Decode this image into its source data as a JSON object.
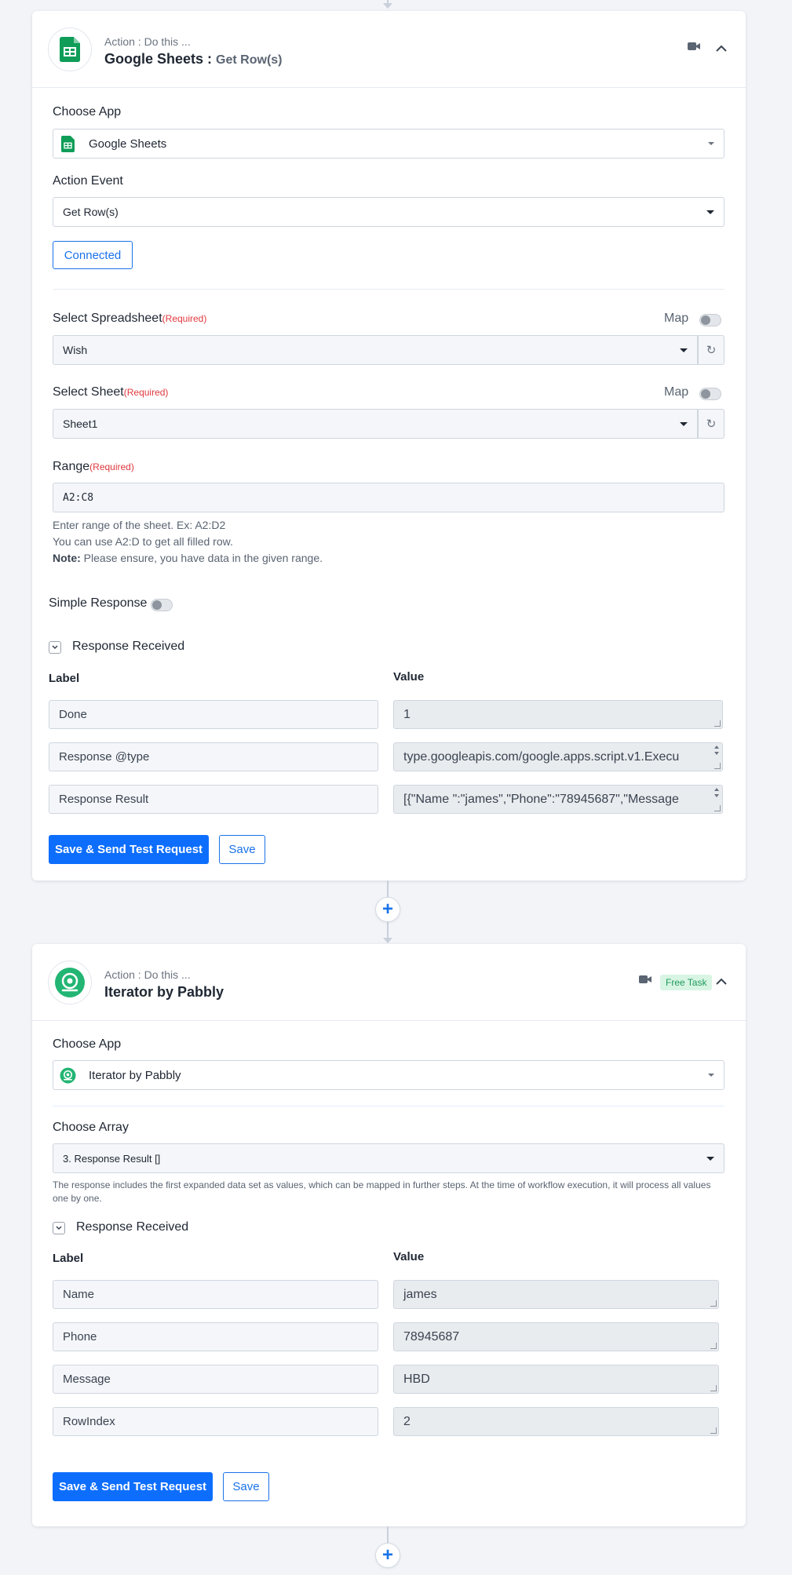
{
  "step1": {
    "header_sub": "Action : Do this ...",
    "app_name": "Google Sheets :",
    "action_name": "Get Row(s)",
    "choose_app_label": "Choose App",
    "choose_app_value": "Google Sheets",
    "action_event_label": "Action Event",
    "action_event_value": "Get Row(s)",
    "connected_label": "Connected",
    "spreadsheet_label": "Select Spreadsheet",
    "spreadsheet_value": "Wish",
    "sheet_label": "Select Sheet",
    "sheet_value": "Sheet1",
    "required": "(Required)",
    "map_label": "Map",
    "range_label": "Range",
    "range_value": "A2:C8",
    "range_help_1": "Enter range of the sheet. Ex: A2:D2",
    "range_help_2": "You can use A2:D to get all filled row.",
    "note_label": "Note:",
    "note_text": " Please ensure, you have data in the given range.",
    "simple_response_label": "Simple Response",
    "response_received_label": "Response Received",
    "col_label": "Label",
    "col_value": "Value",
    "rows": [
      {
        "label": "Done",
        "value": "1"
      },
      {
        "label": "Response @type",
        "value": "type.googleapis.com/google.apps.script.v1.Execu"
      },
      {
        "label": "Response Result",
        "value": "[{\"Name \":\"james\",\"Phone\":\"78945687\",\"Message"
      }
    ],
    "save_send_label": "Save & Send Test Request",
    "save_label": "Save"
  },
  "step2": {
    "header_sub": "Action : Do this ...",
    "app_name": "Iterator by Pabbly",
    "badge": "Free Task",
    "choose_app_label": "Choose App",
    "choose_app_value": "Iterator by Pabbly",
    "choose_array_label": "Choose Array",
    "choose_array_value": "3. Response Result []",
    "array_help": "The response includes the first expanded data set as values, which can be mapped in further steps. At the time of workflow execution, it will process all values one by one.",
    "response_received_label": "Response Received",
    "col_label": "Label",
    "col_value": "Value",
    "rows": [
      {
        "label": "Name",
        "value": "james"
      },
      {
        "label": "Phone",
        "value": "78945687"
      },
      {
        "label": "Message",
        "value": "HBD"
      },
      {
        "label": "RowIndex",
        "value": "2"
      }
    ],
    "save_send_label": "Save & Send Test Request",
    "save_label": "Save"
  },
  "icons": {
    "sheets": "google-sheets-icon",
    "iterator": "iterator-icon",
    "video": "video-icon",
    "collapse": "chevron-up-icon",
    "refresh": "refresh-icon",
    "plus": "plus-icon"
  },
  "colors": {
    "primary": "#0d6efd",
    "sheets_green": "#0f9d58",
    "iterator_green": "#22b573",
    "required_red": "#e0383e"
  }
}
